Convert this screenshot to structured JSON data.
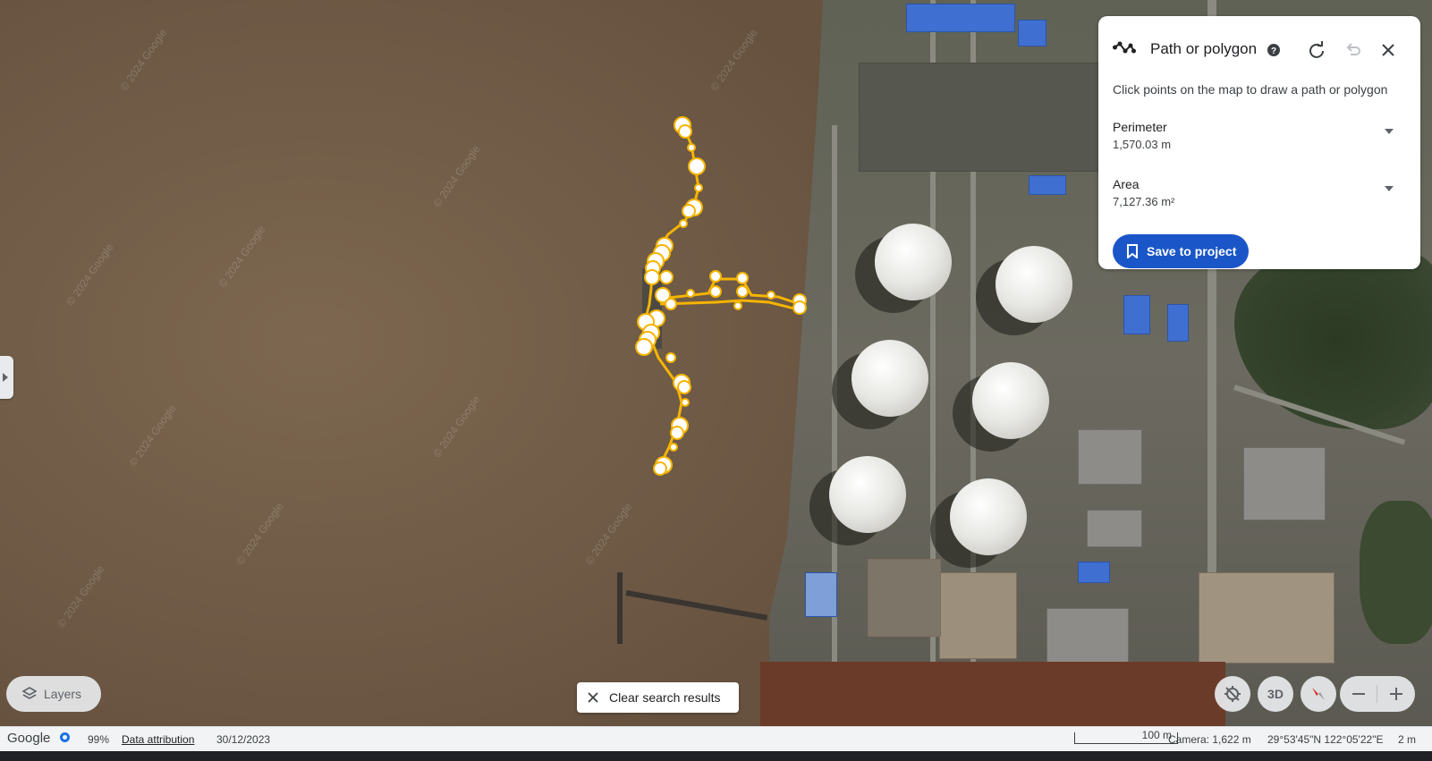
{
  "panel": {
    "title": "Path or polygon",
    "instructions": "Click points on the map to draw a path or polygon",
    "metrics": [
      {
        "label": "Perimeter",
        "value": "1,570.03 m"
      },
      {
        "label": "Area",
        "value": "7,127.36 m²"
      }
    ],
    "save_label": "Save to project",
    "icons": [
      "path-icon",
      "help-icon",
      "redo-icon",
      "undo-icon",
      "close-icon"
    ]
  },
  "controls": {
    "layers_label": "Layers",
    "clear_search_label": "Clear search results",
    "btn_3d_label": "3D"
  },
  "map": {
    "watermark": "© 2024 Google",
    "path_color": "#f5b400"
  },
  "statusbar": {
    "brand": "Google",
    "load_percent": "99%",
    "data_attribution": "Data attribution",
    "imagery_date": "30/12/2023",
    "scale_label": "100 m",
    "camera": "Camera: 1,622 m",
    "coordinates": "29°53'45\"N 122°05'22\"E",
    "elevation": "2 m"
  },
  "colors": {
    "accent": "#1a56c8",
    "path": "#f5b400"
  }
}
